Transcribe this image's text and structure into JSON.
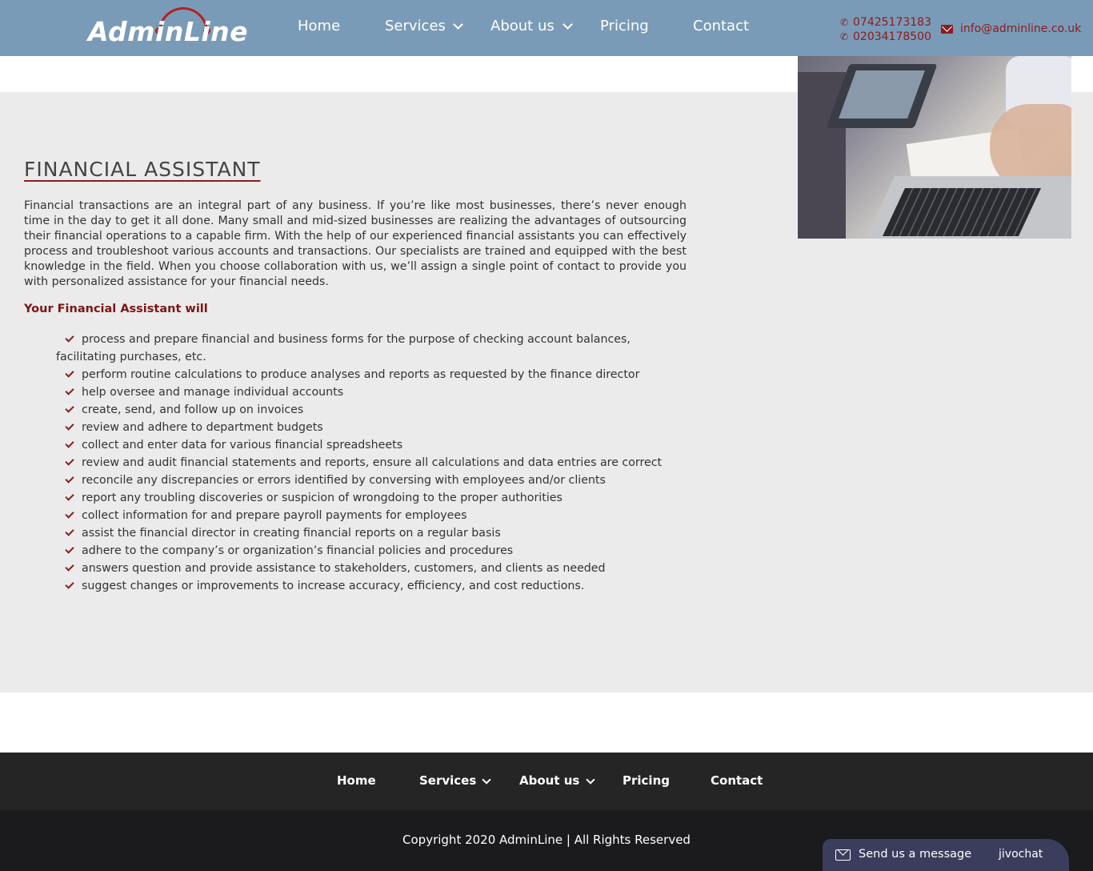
{
  "header": {
    "logo_text": "AdminLine",
    "nav": [
      {
        "label": "Home"
      },
      {
        "label": "Services"
      },
      {
        "label": "About us"
      },
      {
        "label": "Pricing"
      },
      {
        "label": "Contact"
      }
    ],
    "phones": [
      "07425173183",
      "02034178500"
    ],
    "email": "info@adminline.co.uk"
  },
  "main": {
    "title": "FINANCIAL ASSISTANT",
    "intro": "Financial transactions are an integral part of any business. If you’re like most businesses, there’s never enough time in the day to get it all done. Many small and mid-sized businesses are realizing the advantages of outsourcing their financial operations to a capable firm. With the help of our experienced financial assistants you can effectively process and troubleshoot various accounts and transactions. Our specialists are trained and equipped with the best knowledge in the field. When you choose collaboration with us, we’ll assign a single point of contact to provide you with personalized assistance for your financial needs.",
    "subhead": "Your Financial Assistant will",
    "duties": [
      "process and prepare financial and business forms for the purpose of checking account balances, facilitating purchases, etc.",
      "perform routine calculations to produce analyses and reports as requested by the finance director",
      "help oversee and manage individual accounts",
      "create, send, and follow up on invoices",
      "review and adhere to department budgets",
      "collect and enter data for various financial spreadsheets",
      "review and audit financial statements and reports, ensure all calculations and data entries are correct",
      "reconcile any discrepancies or errors identified by conversing with employees and/or clients",
      "report any troubling discoveries or suspicion of wrongdoing to the proper authorities",
      "collect information for and prepare payroll payments for employees",
      "assist the financial director in creating financial reports on a regular basis",
      "adhere to the company’s or organization’s financial policies and procedures",
      "answers question and provide assistance to stakeholders, customers, and clients as needed",
      "suggest changes or improvements to increase accuracy, efficiency, and cost reductions."
    ]
  },
  "footer": {
    "nav": [
      {
        "label": "Home"
      },
      {
        "label": "Services"
      },
      {
        "label": "About us"
      },
      {
        "label": "Pricing"
      },
      {
        "label": "Contact"
      }
    ],
    "copyright": "Copyright 2020 AdminLine | All Rights Reserved"
  },
  "chat": {
    "label": "Send us a message",
    "brand": "jivochat"
  },
  "colors": {
    "header_bg": "#7a9bb7",
    "accent": "#8b1c1c",
    "content_bg": "#ebebeb",
    "footer_bg": "#252526",
    "footer_bottom_bg": "#1b1b1d",
    "chat_bg": "#3a3d5c"
  },
  "icons": [
    "phone-icon",
    "mail-icon",
    "chevron-down-icon",
    "check-icon",
    "chat-icon"
  ]
}
